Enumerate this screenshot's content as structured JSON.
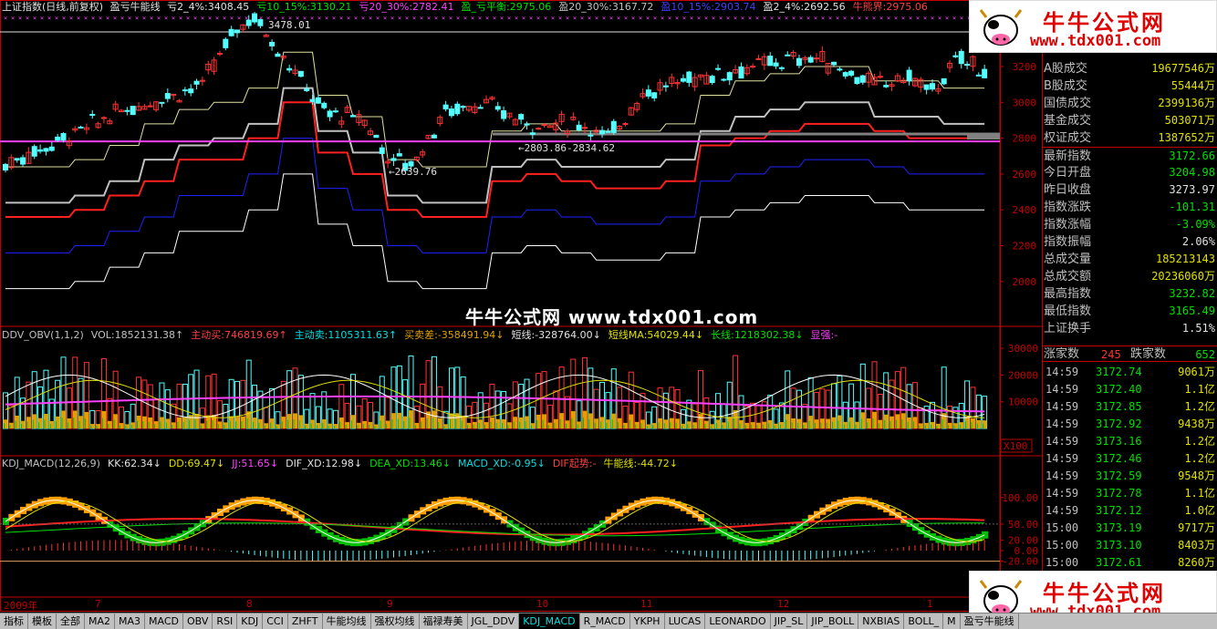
{
  "title_legend": {
    "name": "上证指数(日线,前复权)",
    "indicator": "盈亏牛能线",
    "items": [
      {
        "text": "亏2_4%:3408.45",
        "color": "#e0e0e0"
      },
      {
        "text": "亏10_15%:3130.21",
        "color": "#00e000"
      },
      {
        "text": "亏20_30%:2782.41",
        "color": "#ff40ff"
      },
      {
        "text": "盈_亏平衡:2975.06",
        "color": "#00e000"
      },
      {
        "text": "盈20_30%:3167.72",
        "color": "#c0c0c0"
      },
      {
        "text": "盈10_15%:2903.74",
        "color": "#4040ff"
      },
      {
        "text": "盈2_4%:2692.56",
        "color": "#e0e0e0"
      },
      {
        "text": "牛熊界:2975.06",
        "color": "#ff4040"
      }
    ]
  },
  "annotations": {
    "high": "3478.01",
    "low1": "2639.76",
    "gap": "2803.86-2834.62"
  },
  "watermark": {
    "center": "牛牛公式网 www.tdx001.com",
    "logo_title": "牛牛公式网",
    "logo_url": "www.tdx001.com"
  },
  "vol_legend": {
    "items": [
      {
        "text": "DDV_OBV(1,1,2)",
        "color": "#c0c0c0"
      },
      {
        "text": "VOL:1852131.38↑",
        "color": "#c0c0c0"
      },
      {
        "text": "主动买:746819.69↑",
        "color": "#ff4040"
      },
      {
        "text": "主动卖:1105311.63↑",
        "color": "#00e0e0"
      },
      {
        "text": "买卖差:-358491.94↓",
        "color": "#e0a000"
      },
      {
        "text": "短线:-328764.00↓",
        "color": "#e0e0e0"
      },
      {
        "text": "短线MA:54029.44↓",
        "color": "#e0e000"
      },
      {
        "text": "长线:1218302.38↓",
        "color": "#00e000"
      },
      {
        "text": "显强:-",
        "color": "#ff40ff"
      }
    ]
  },
  "kdj_legend": {
    "items": [
      {
        "text": "KDJ_MACD(12,26,9)",
        "color": "#c0c0c0"
      },
      {
        "text": "KK:62.34↓",
        "color": "#e0e0e0"
      },
      {
        "text": "DD:69.47↓",
        "color": "#e0e000"
      },
      {
        "text": "JJ:51.65↓",
        "color": "#ff40ff"
      },
      {
        "text": "DIF_XD:12.98↓",
        "color": "#e0e0e0"
      },
      {
        "text": "DEA_XD:13.46↓",
        "color": "#00e000"
      },
      {
        "text": "MACD_XD:-0.95↓",
        "color": "#00e0e0"
      },
      {
        "text": "DIF起势:-",
        "color": "#ff4040"
      },
      {
        "text": "牛能线:-44.72↓",
        "color": "#e0e000"
      }
    ]
  },
  "y_axis_price": [
    "3200",
    "3000",
    "2800",
    "2600",
    "2400",
    "2200",
    "2000"
  ],
  "y_axis_vol": [
    "30000",
    "20000",
    "10000"
  ],
  "vol_unit": "X100",
  "y_axis_kdj": [
    "100.00",
    "50.00",
    "20.00",
    "0.00",
    "-20.00"
  ],
  "x_axis": [
    {
      "label": "2009年"
    },
    {
      "label": "7"
    },
    {
      "label": "8"
    },
    {
      "label": "9"
    },
    {
      "label": "10"
    },
    {
      "label": "11"
    },
    {
      "label": "12"
    },
    {
      "label": "1"
    }
  ],
  "stats": [
    {
      "key": "A股成交",
      "value": "19677546万",
      "color": "#e0e000"
    },
    {
      "key": "B股成交",
      "value": "55444万",
      "color": "#e0e000"
    },
    {
      "key": "国债成交",
      "value": "2399136万",
      "color": "#e0e000"
    },
    {
      "key": "基金成交",
      "value": "503071万",
      "color": "#e0e000"
    },
    {
      "key": "权证成交",
      "value": "1387652万",
      "color": "#e0e000"
    },
    {
      "key": "最新指数",
      "value": "3172.66",
      "color": "#00e000"
    },
    {
      "key": "今日开盘",
      "value": "3204.98",
      "color": "#00e000"
    },
    {
      "key": "昨日收盘",
      "value": "3273.97",
      "color": "#e0e0e0"
    },
    {
      "key": "指数涨跌",
      "value": "-101.31",
      "color": "#00e000"
    },
    {
      "key": "指数涨幅",
      "value": "-3.09%",
      "color": "#00e000"
    },
    {
      "key": "指数振幅",
      "value": "2.06%",
      "color": "#e0e0e0"
    },
    {
      "key": "总成交量",
      "value": "185213143",
      "color": "#e0e000"
    },
    {
      "key": "总成交额",
      "value": "20236060万",
      "color": "#e0e000"
    },
    {
      "key": "最高指数",
      "value": "3232.82",
      "color": "#00e000"
    },
    {
      "key": "最低指数",
      "value": "3165.49",
      "color": "#00e000"
    },
    {
      "key": "上证换手",
      "value": "1.51%",
      "color": "#e0e0e0"
    }
  ],
  "updown": {
    "up_label": "涨家数",
    "up": "245",
    "down_label": "跌家数",
    "down": "652"
  },
  "ticks": [
    {
      "t": "14:59",
      "p": "3172.74",
      "q": "9061万"
    },
    {
      "t": "14:59",
      "p": "3172.40",
      "q": "1.1亿"
    },
    {
      "t": "14:59",
      "p": "3172.85",
      "q": "1.2亿"
    },
    {
      "t": "14:59",
      "p": "3172.92",
      "q": "9438万"
    },
    {
      "t": "14:59",
      "p": "3173.16",
      "q": "1.2亿"
    },
    {
      "t": "14:59",
      "p": "3172.46",
      "q": "1.2亿"
    },
    {
      "t": "14:59",
      "p": "3172.59",
      "q": "9548万"
    },
    {
      "t": "14:59",
      "p": "3172.78",
      "q": "1.1亿"
    },
    {
      "t": "14:59",
      "p": "3172.12",
      "q": "1.0亿"
    },
    {
      "t": "15:00",
      "p": "3173.19",
      "q": "9717万"
    },
    {
      "t": "15:00",
      "p": "3173.10",
      "q": "8403万"
    },
    {
      "t": "15:00",
      "p": "3172.61",
      "q": "8260万"
    }
  ],
  "tabs": [
    "指标",
    "模板",
    "全部",
    "MA2",
    "MA3",
    "MACD",
    "OBV",
    "RSI",
    "KDJ",
    "CCI",
    "ZHFT",
    "牛能均线",
    "强权均线",
    "福禄寿美",
    "JGL_DDV",
    "KDJ_MACD",
    "R_MACD",
    "YKPH",
    "LUCAS",
    "LEONARDO",
    "JIP_SL",
    "JIP_BOLL",
    "NXBIAS",
    "BOLL_",
    "M",
    "盈亏牛能线"
  ],
  "active_tab": "KDJ_MACD",
  "colors": {
    "up": "#ff3232",
    "down": "#54ffff",
    "axis": "#c00000",
    "bg": "#000000"
  }
}
